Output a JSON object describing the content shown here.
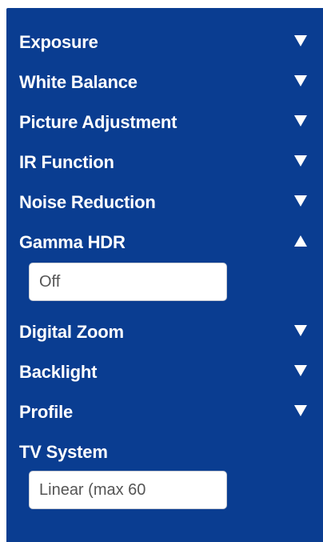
{
  "colors": {
    "panel_bg": "#0a3d91",
    "text": "#ffffff",
    "field_bg": "#ffffff",
    "field_text": "#555555"
  },
  "menu": {
    "items": [
      {
        "label": "Exposure",
        "icon": "triangle-down-icon",
        "expanded": false
      },
      {
        "label": "White Balance",
        "icon": "triangle-down-icon",
        "expanded": false
      },
      {
        "label": "Picture Adjustment",
        "icon": "triangle-down-icon",
        "expanded": false
      },
      {
        "label": "IR Function",
        "icon": "triangle-down-icon",
        "expanded": false
      },
      {
        "label": "Noise Reduction",
        "icon": "triangle-down-icon",
        "expanded": false
      },
      {
        "label": "Gamma HDR",
        "icon": "triangle-up-icon",
        "expanded": true
      },
      {
        "label": "Digital Zoom",
        "icon": "triangle-down-icon",
        "expanded": false
      },
      {
        "label": "Backlight",
        "icon": "triangle-down-icon",
        "expanded": false
      },
      {
        "label": "Profile",
        "icon": "triangle-down-icon",
        "expanded": false
      },
      {
        "label": "TV System"
      }
    ]
  },
  "gamma_hdr": {
    "select_value": "Off"
  },
  "tv_system": {
    "select_value": "Linear (max 60"
  }
}
